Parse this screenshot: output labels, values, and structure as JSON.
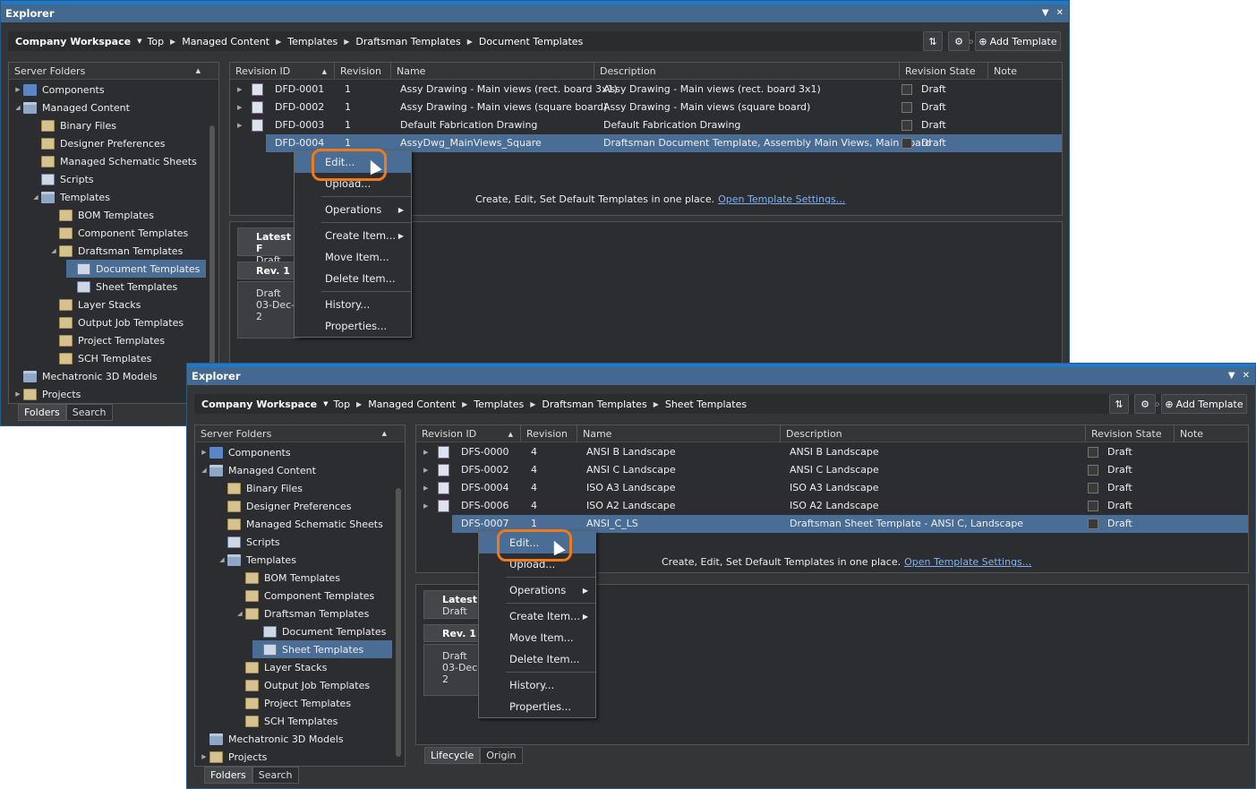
{
  "w1": {
    "title": "Explorer",
    "workspace": "Company Workspace",
    "crumbs": [
      "Top",
      "Managed Content",
      "Templates",
      "Draftsman Templates",
      "Document Templates"
    ],
    "add_label": "Add Template",
    "folders_header": "Server Folders",
    "tree": [
      {
        "label": "Components",
        "indent": 0,
        "icon": "comp",
        "arrow": "▶",
        "sel": false
      },
      {
        "label": "Managed Content",
        "indent": 0,
        "icon": "folder",
        "arrow": "◢",
        "sel": false
      },
      {
        "label": "Binary Files",
        "indent": 1,
        "icon": "tpl",
        "arrow": "",
        "sel": false
      },
      {
        "label": "Designer Preferences",
        "indent": 1,
        "icon": "tpl",
        "arrow": "",
        "sel": false
      },
      {
        "label": "Managed Schematic Sheets",
        "indent": 1,
        "icon": "tpl",
        "arrow": "",
        "sel": false
      },
      {
        "label": "Scripts",
        "indent": 1,
        "icon": "doc",
        "arrow": "",
        "sel": false
      },
      {
        "label": "Templates",
        "indent": 1,
        "icon": "folder",
        "arrow": "◢",
        "sel": false
      },
      {
        "label": "BOM Templates",
        "indent": 2,
        "icon": "tpl",
        "arrow": "",
        "sel": false
      },
      {
        "label": "Component Templates",
        "indent": 2,
        "icon": "tpl",
        "arrow": "",
        "sel": false
      },
      {
        "label": "Draftsman Templates",
        "indent": 2,
        "icon": "tpl",
        "arrow": "◢",
        "sel": false
      },
      {
        "label": "Document Templates",
        "indent": 3,
        "icon": "doc",
        "arrow": "",
        "sel": true
      },
      {
        "label": "Sheet Templates",
        "indent": 3,
        "icon": "doc",
        "arrow": "",
        "sel": false
      },
      {
        "label": "Layer Stacks",
        "indent": 2,
        "icon": "tpl",
        "arrow": "",
        "sel": false
      },
      {
        "label": "Output Job Templates",
        "indent": 2,
        "icon": "tpl",
        "arrow": "",
        "sel": false
      },
      {
        "label": "Project Templates",
        "indent": 2,
        "icon": "tpl",
        "arrow": "",
        "sel": false
      },
      {
        "label": "SCH Templates",
        "indent": 2,
        "icon": "tpl",
        "arrow": "",
        "sel": false
      },
      {
        "label": "Mechatronic 3D Models",
        "indent": 0,
        "icon": "folder",
        "arrow": "",
        "sel": false
      },
      {
        "label": "Projects",
        "indent": 0,
        "icon": "tpl",
        "arrow": "▶",
        "sel": false
      }
    ],
    "tabs": [
      "Folders",
      "Search"
    ],
    "columns": [
      "Revision ID",
      "Revision",
      "Name",
      "Description",
      "Revision State",
      "Note"
    ],
    "rows": [
      {
        "id": "DFD-0001",
        "rev": "1",
        "name": "Assy Drawing - Main views (rect. board 3x1)",
        "desc": "Assy Drawing - Main views (rect. board 3x1)",
        "state": "Draft",
        "sel": false
      },
      {
        "id": "DFD-0002",
        "rev": "1",
        "name": "Assy Drawing - Main views (square board)",
        "desc": "Assy Drawing - Main views (square board)",
        "state": "Draft",
        "sel": false
      },
      {
        "id": "DFD-0003",
        "rev": "1",
        "name": "Default Fabrication Drawing",
        "desc": "Default Fabrication Drawing",
        "state": "Draft",
        "sel": false
      },
      {
        "id": "DFD-0004",
        "rev": "1",
        "name": "AssyDwg_MainViews_Square",
        "desc": "Draftsman Document Template, Assembly Main Views, Main Board",
        "state": "Draft",
        "sel": true
      }
    ],
    "info_text": "Create, Edit, Set Default Templates in one place.",
    "info_link": "Open Template Settings...",
    "lifecycle": {
      "latest": "Latest - F",
      "latest_state": "Draft",
      "rev": "Rev. 1",
      "rev_state": "Draft",
      "rev_date": "03-Dec-2"
    }
  },
  "w2": {
    "title": "Explorer",
    "workspace": "Company Workspace",
    "crumbs": [
      "Top",
      "Managed Content",
      "Templates",
      "Draftsman Templates",
      "Sheet Templates"
    ],
    "add_label": "Add Template",
    "folders_header": "Server Folders",
    "tree": [
      {
        "label": "Components",
        "indent": 0,
        "icon": "comp",
        "arrow": "▶",
        "sel": false
      },
      {
        "label": "Managed Content",
        "indent": 0,
        "icon": "folder",
        "arrow": "◢",
        "sel": false
      },
      {
        "label": "Binary Files",
        "indent": 1,
        "icon": "tpl",
        "arrow": "",
        "sel": false
      },
      {
        "label": "Designer Preferences",
        "indent": 1,
        "icon": "tpl",
        "arrow": "",
        "sel": false
      },
      {
        "label": "Managed Schematic Sheets",
        "indent": 1,
        "icon": "tpl",
        "arrow": "",
        "sel": false
      },
      {
        "label": "Scripts",
        "indent": 1,
        "icon": "doc",
        "arrow": "",
        "sel": false
      },
      {
        "label": "Templates",
        "indent": 1,
        "icon": "folder",
        "arrow": "◢",
        "sel": false
      },
      {
        "label": "BOM Templates",
        "indent": 2,
        "icon": "tpl",
        "arrow": "",
        "sel": false
      },
      {
        "label": "Component Templates",
        "indent": 2,
        "icon": "tpl",
        "arrow": "",
        "sel": false
      },
      {
        "label": "Draftsman Templates",
        "indent": 2,
        "icon": "tpl",
        "arrow": "◢",
        "sel": false
      },
      {
        "label": "Document Templates",
        "indent": 3,
        "icon": "doc",
        "arrow": "",
        "sel": false
      },
      {
        "label": "Sheet Templates",
        "indent": 3,
        "icon": "doc",
        "arrow": "",
        "sel": true
      },
      {
        "label": "Layer Stacks",
        "indent": 2,
        "icon": "tpl",
        "arrow": "",
        "sel": false
      },
      {
        "label": "Output Job Templates",
        "indent": 2,
        "icon": "tpl",
        "arrow": "",
        "sel": false
      },
      {
        "label": "Project Templates",
        "indent": 2,
        "icon": "tpl",
        "arrow": "",
        "sel": false
      },
      {
        "label": "SCH Templates",
        "indent": 2,
        "icon": "tpl",
        "arrow": "",
        "sel": false
      },
      {
        "label": "Mechatronic 3D Models",
        "indent": 0,
        "icon": "folder",
        "arrow": "",
        "sel": false
      },
      {
        "label": "Projects",
        "indent": 0,
        "icon": "tpl",
        "arrow": "▶",
        "sel": false
      }
    ],
    "tabs": [
      "Folders",
      "Search"
    ],
    "columns": [
      "Revision ID",
      "Revision",
      "Name",
      "Description",
      "Revision State",
      "Note"
    ],
    "rows": [
      {
        "id": "DFS-0000",
        "rev": "4",
        "name": "ANSI B Landscape",
        "desc": "ANSI B Landscape",
        "state": "Draft",
        "sel": false
      },
      {
        "id": "DFS-0002",
        "rev": "4",
        "name": "ANSI C Landscape",
        "desc": "ANSI C Landscape",
        "state": "Draft",
        "sel": false
      },
      {
        "id": "DFS-0004",
        "rev": "4",
        "name": "ISO A3 Landscape",
        "desc": "ISO A3 Landscape",
        "state": "Draft",
        "sel": false
      },
      {
        "id": "DFS-0006",
        "rev": "4",
        "name": "ISO A2 Landscape",
        "desc": "ISO A2 Landscape",
        "state": "Draft",
        "sel": false
      },
      {
        "id": "DFS-0007",
        "rev": "1",
        "name": "ANSI_C_LS",
        "desc": "Draftsman Sheet Template - ANSI C, Landscape",
        "state": "Draft",
        "sel": true
      }
    ],
    "info_text": "Create, Edit, Set Default Templates in one place.",
    "info_link": "Open Template Settings...",
    "lifecycle": {
      "latest": "Latest -",
      "latest_state": "Draft",
      "rev": "Rev. 1",
      "rev_state": "Draft",
      "rev_date": "03-Dec-2"
    },
    "bottom_tabs": [
      "Lifecycle",
      "Origin"
    ]
  },
  "menu": [
    {
      "label": "Edit...",
      "sub": false,
      "sep_after": false,
      "hl": true
    },
    {
      "label": "Upload...",
      "sub": false,
      "sep_after": true,
      "hl": false
    },
    {
      "label": "Operations",
      "sub": true,
      "sep_after": true,
      "hl": false
    },
    {
      "label": "Create Item...",
      "sub": true,
      "sep_after": false,
      "hl": false
    },
    {
      "label": "Move Item...",
      "sub": false,
      "sep_after": false,
      "hl": false
    },
    {
      "label": "Delete Item...",
      "sub": false,
      "sep_after": true,
      "hl": false
    },
    {
      "label": "History...",
      "sub": false,
      "sep_after": false,
      "hl": false
    },
    {
      "label": "Properties...",
      "sub": false,
      "sep_after": false,
      "hl": false
    }
  ]
}
